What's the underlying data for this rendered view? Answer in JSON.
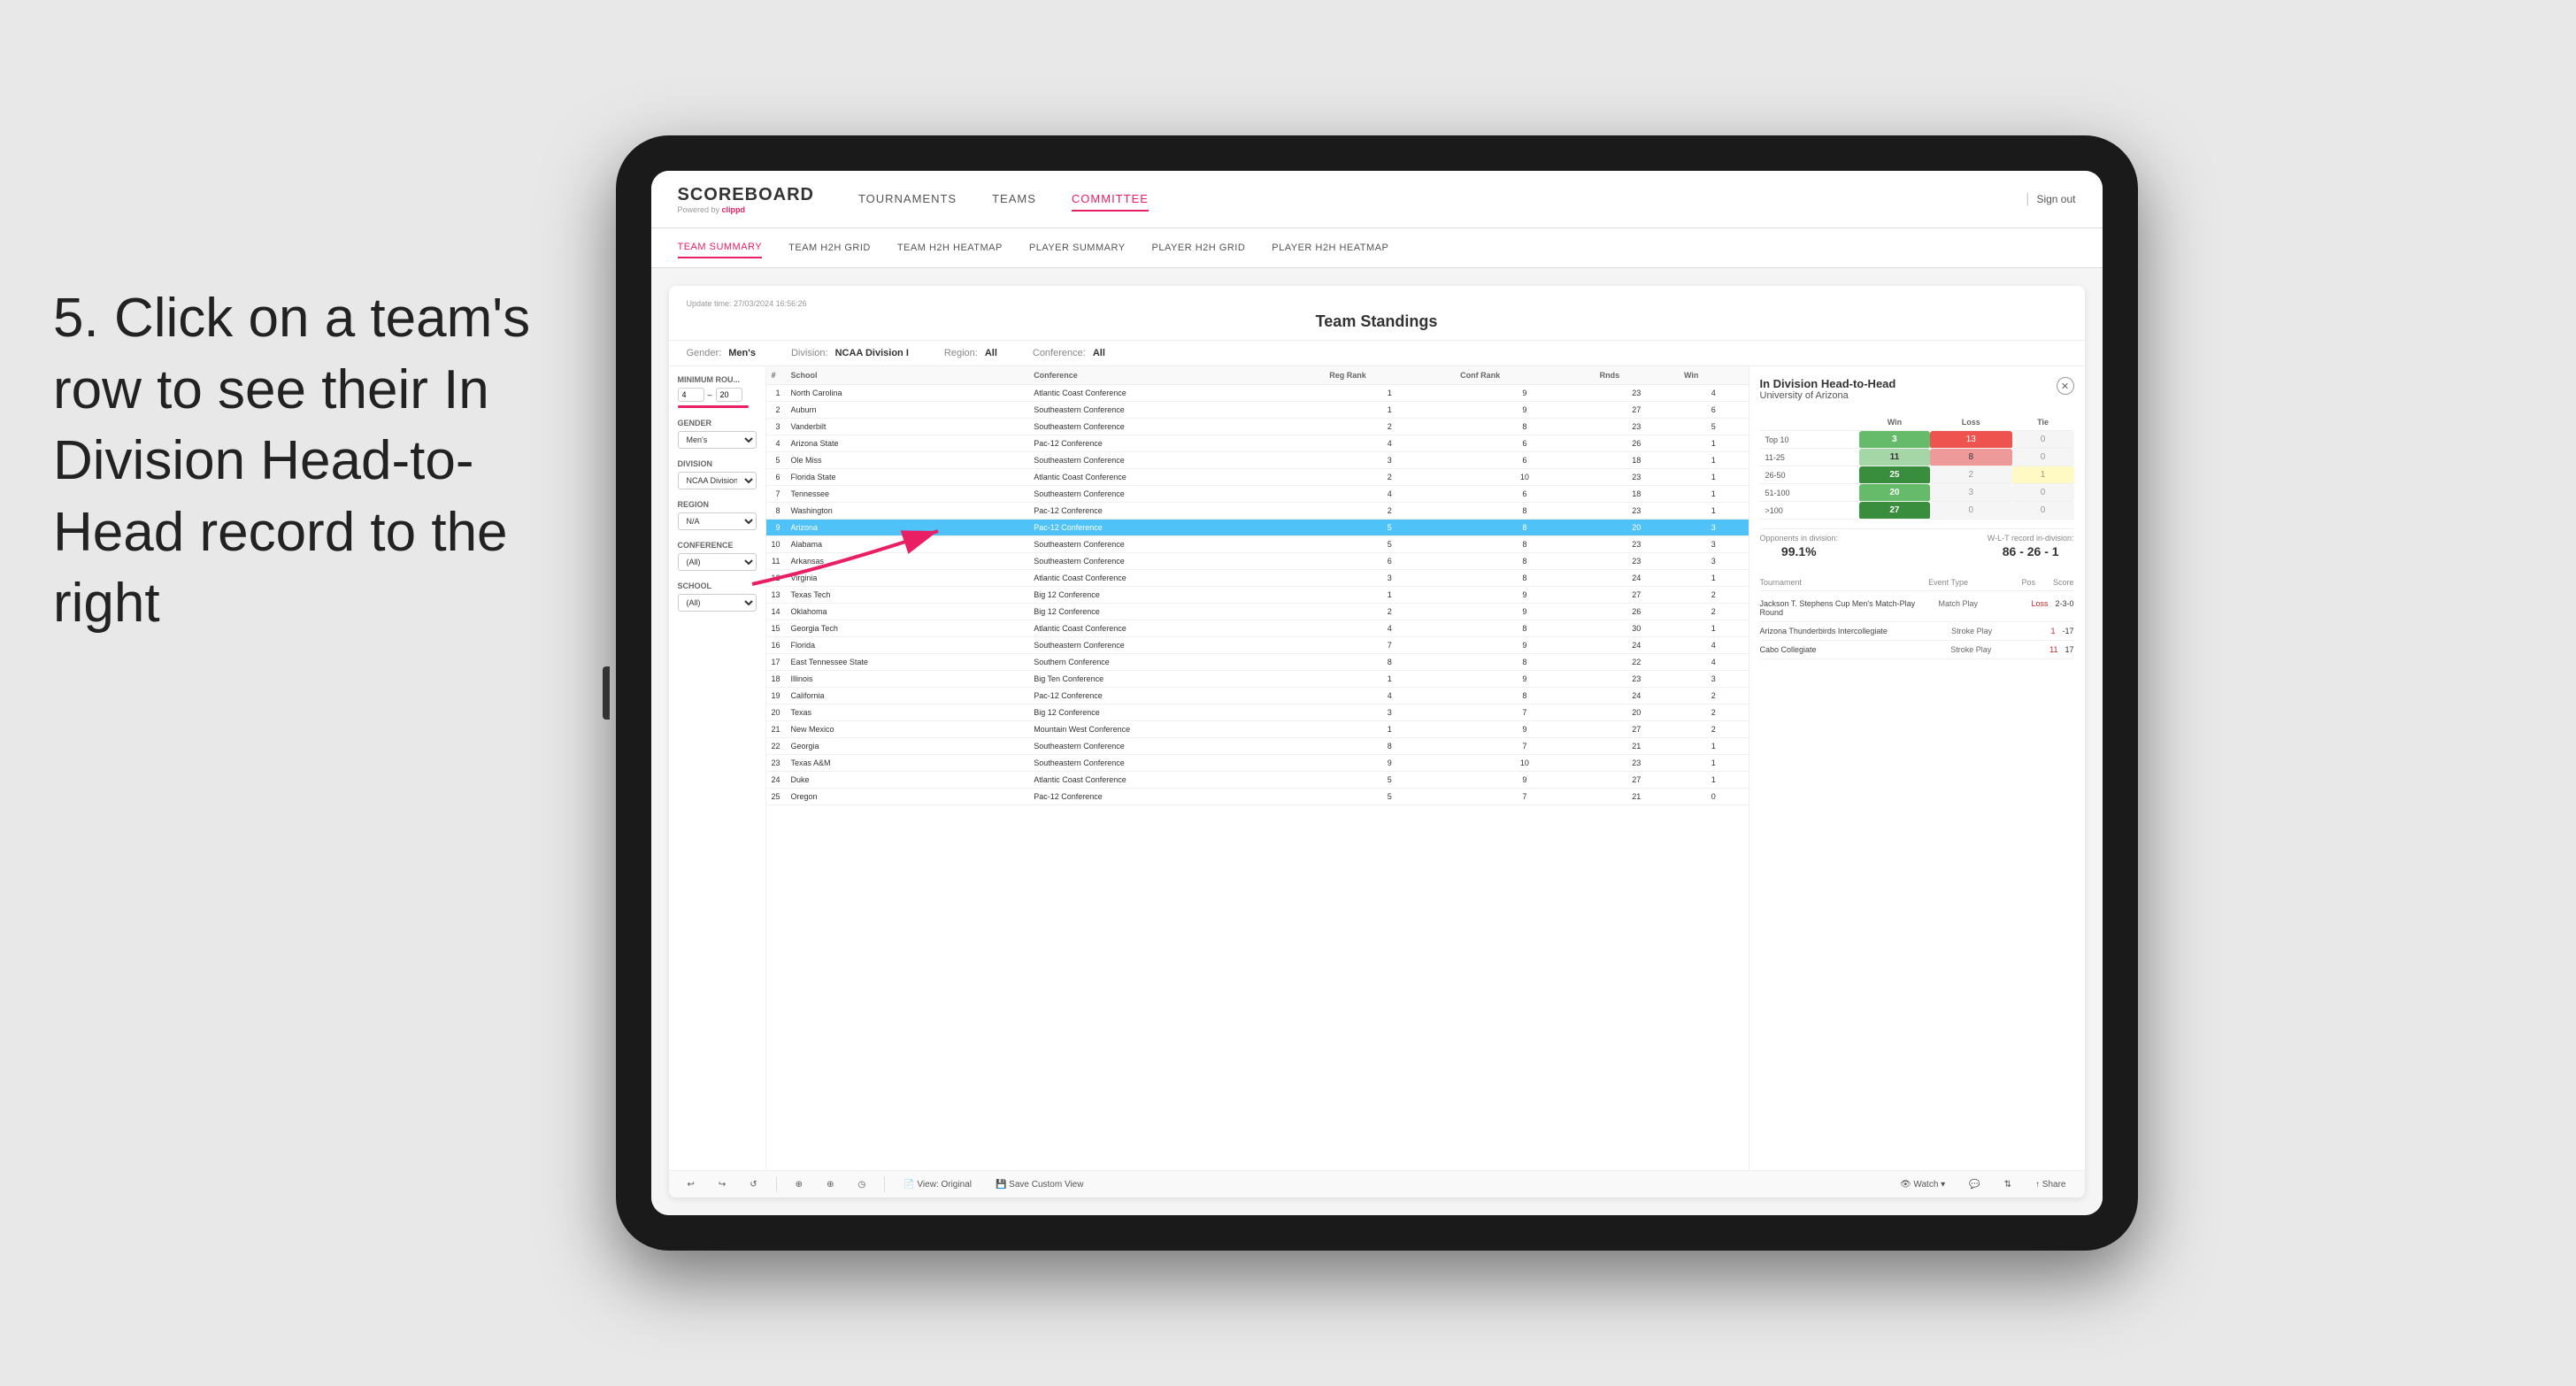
{
  "instruction": {
    "step": "5.",
    "text": "Click on a team's row to see their In Division Head-to-Head record to the right"
  },
  "nav": {
    "logo": "SCOREBOARD",
    "logo_sub": "Powered by clippd",
    "links": [
      "TOURNAMENTS",
      "TEAMS",
      "COMMITTEE"
    ],
    "active_link": "COMMITTEE",
    "sign_out": "Sign out"
  },
  "sub_nav": {
    "links": [
      "TEAM SUMMARY",
      "TEAM H2H GRID",
      "TEAM H2H HEATMAP",
      "PLAYER SUMMARY",
      "PLAYER H2H GRID",
      "PLAYER H2H HEATMAP"
    ],
    "active": "TEAM SUMMARY"
  },
  "panel": {
    "update_time": "Update time: 27/03/2024 16:56:26",
    "title": "Team Standings",
    "filters": {
      "gender": "Men's",
      "division": "NCAA Division I",
      "region": "All",
      "conference": "All"
    }
  },
  "sidebar_filters": {
    "minimum_rounds_label": "Minimum Rou...",
    "min_val": "4",
    "max_val": "20",
    "gender_label": "Gender",
    "gender_val": "Men's",
    "division_label": "Division",
    "division_val": "NCAA Division I",
    "region_label": "Region",
    "region_val": "N/A",
    "conference_label": "Conference",
    "conference_val": "(All)",
    "school_label": "School",
    "school_val": "(All)"
  },
  "table": {
    "headers": [
      "#",
      "School",
      "Conference",
      "Reg Rank",
      "Conf Rank",
      "Rds",
      "Win"
    ],
    "rows": [
      {
        "rank": 1,
        "school": "North Carolina",
        "conference": "Atlantic Coast Conference",
        "reg_rank": 1,
        "conf_rank": 9,
        "rds": 23,
        "win": 4
      },
      {
        "rank": 2,
        "school": "Auburn",
        "conference": "Southeastern Conference",
        "reg_rank": 1,
        "conf_rank": 9,
        "rds": 27,
        "win": 6
      },
      {
        "rank": 3,
        "school": "Vanderbilt",
        "conference": "Southeastern Conference",
        "reg_rank": 2,
        "conf_rank": 8,
        "rds": 23,
        "win": 5
      },
      {
        "rank": 4,
        "school": "Arizona State",
        "conference": "Pac-12 Conference",
        "reg_rank": 4,
        "conf_rank": 6,
        "rds": 26,
        "win": 1
      },
      {
        "rank": 5,
        "school": "Ole Miss",
        "conference": "Southeastern Conference",
        "reg_rank": 3,
        "conf_rank": 6,
        "rds": 18,
        "win": 1
      },
      {
        "rank": 6,
        "school": "Florida State",
        "conference": "Atlantic Coast Conference",
        "reg_rank": 2,
        "conf_rank": 10,
        "rds": 23,
        "win": 1
      },
      {
        "rank": 7,
        "school": "Tennessee",
        "conference": "Southeastern Conference",
        "reg_rank": 4,
        "conf_rank": 6,
        "rds": 18,
        "win": 1
      },
      {
        "rank": 8,
        "school": "Washington",
        "conference": "Pac-12 Conference",
        "reg_rank": 2,
        "conf_rank": 8,
        "rds": 23,
        "win": 1
      },
      {
        "rank": 9,
        "school": "Arizona",
        "conference": "Pac-12 Conference",
        "reg_rank": 5,
        "conf_rank": 8,
        "rds": 20,
        "win": 3,
        "highlighted": true
      },
      {
        "rank": 10,
        "school": "Alabama",
        "conference": "Southeastern Conference",
        "reg_rank": 5,
        "conf_rank": 8,
        "rds": 23,
        "win": 3
      },
      {
        "rank": 11,
        "school": "Arkansas",
        "conference": "Southeastern Conference",
        "reg_rank": 6,
        "conf_rank": 8,
        "rds": 23,
        "win": 3
      },
      {
        "rank": 12,
        "school": "Virginia",
        "conference": "Atlantic Coast Conference",
        "reg_rank": 3,
        "conf_rank": 8,
        "rds": 24,
        "win": 1
      },
      {
        "rank": 13,
        "school": "Texas Tech",
        "conference": "Big 12 Conference",
        "reg_rank": 1,
        "conf_rank": 9,
        "rds": 27,
        "win": 2
      },
      {
        "rank": 14,
        "school": "Oklahoma",
        "conference": "Big 12 Conference",
        "reg_rank": 2,
        "conf_rank": 9,
        "rds": 26,
        "win": 2
      },
      {
        "rank": 15,
        "school": "Georgia Tech",
        "conference": "Atlantic Coast Conference",
        "reg_rank": 4,
        "conf_rank": 8,
        "rds": 30,
        "win": 1
      },
      {
        "rank": 16,
        "school": "Florida",
        "conference": "Southeastern Conference",
        "reg_rank": 7,
        "conf_rank": 9,
        "rds": 24,
        "win": 4
      },
      {
        "rank": 17,
        "school": "East Tennessee State",
        "conference": "Southern Conference",
        "reg_rank": 8,
        "conf_rank": 8,
        "rds": 22,
        "win": 4
      },
      {
        "rank": 18,
        "school": "Illinois",
        "conference": "Big Ten Conference",
        "reg_rank": 1,
        "conf_rank": 9,
        "rds": 23,
        "win": 3
      },
      {
        "rank": 19,
        "school": "California",
        "conference": "Pac-12 Conference",
        "reg_rank": 4,
        "conf_rank": 8,
        "rds": 24,
        "win": 2
      },
      {
        "rank": 20,
        "school": "Texas",
        "conference": "Big 12 Conference",
        "reg_rank": 3,
        "conf_rank": 7,
        "rds": 20,
        "win": 2
      },
      {
        "rank": 21,
        "school": "New Mexico",
        "conference": "Mountain West Conference",
        "reg_rank": 1,
        "conf_rank": 9,
        "rds": 27,
        "win": 2
      },
      {
        "rank": 22,
        "school": "Georgia",
        "conference": "Southeastern Conference",
        "reg_rank": 8,
        "conf_rank": 7,
        "rds": 21,
        "win": 1
      },
      {
        "rank": 23,
        "school": "Texas A&M",
        "conference": "Southeastern Conference",
        "reg_rank": 9,
        "conf_rank": 10,
        "rds": 23,
        "win": 1
      },
      {
        "rank": 24,
        "school": "Duke",
        "conference": "Atlantic Coast Conference",
        "reg_rank": 5,
        "conf_rank": 9,
        "rds": 27,
        "win": 1
      },
      {
        "rank": 25,
        "school": "Oregon",
        "conference": "Pac-12 Conference",
        "reg_rank": 5,
        "conf_rank": 7,
        "rds": 21,
        "win": 0
      }
    ]
  },
  "h2h_panel": {
    "title": "In Division Head-to-Head",
    "university": "University of Arizona",
    "headers": [
      "",
      "Win",
      "Loss",
      "Tie"
    ],
    "rows": [
      {
        "range": "Top 10",
        "win": 3,
        "loss": 13,
        "tie": 0,
        "win_color": "green",
        "loss_color": "red"
      },
      {
        "range": "11-25",
        "win": 11,
        "loss": 8,
        "tie": 0,
        "win_color": "lightgreen",
        "loss_color": "lightred"
      },
      {
        "range": "26-50",
        "win": 25,
        "loss": 2,
        "tie": 1,
        "win_color": "darkgreen",
        "loss_color": "white"
      },
      {
        "range": "51-100",
        "win": 20,
        "loss": 3,
        "tie": 0,
        "win_color": "green",
        "loss_color": "white"
      },
      {
        "range": ">100",
        "win": 27,
        "loss": 0,
        "tie": 0,
        "win_color": "green",
        "loss_color": "zero"
      }
    ],
    "opponents_label": "Opponents in division:",
    "opponents_val": "99.1%",
    "wlt_label": "W-L-T record in-division:",
    "wlt_val": "86 - 26 - 1",
    "tournaments": [
      {
        "name": "Jackson T. Stephens Cup Men's Match-Play Round",
        "type": "Match Play",
        "result": "Loss",
        "score": "2-3-0"
      },
      {
        "name": "Arizona Thunderbirds Intercollegiate",
        "type": "Stroke Play",
        "result": "1",
        "score": "-17"
      },
      {
        "name": "Cabo Collegiate",
        "type": "Stroke Play",
        "result": "11",
        "score": "17"
      }
    ]
  },
  "toolbar": {
    "buttons": [
      "↩",
      "↪",
      "↺",
      "⊕",
      "⊕",
      "◷",
      "View: Original",
      "Save Custom View",
      "👁 Watch",
      "📋",
      "↑↓",
      "Share"
    ]
  }
}
